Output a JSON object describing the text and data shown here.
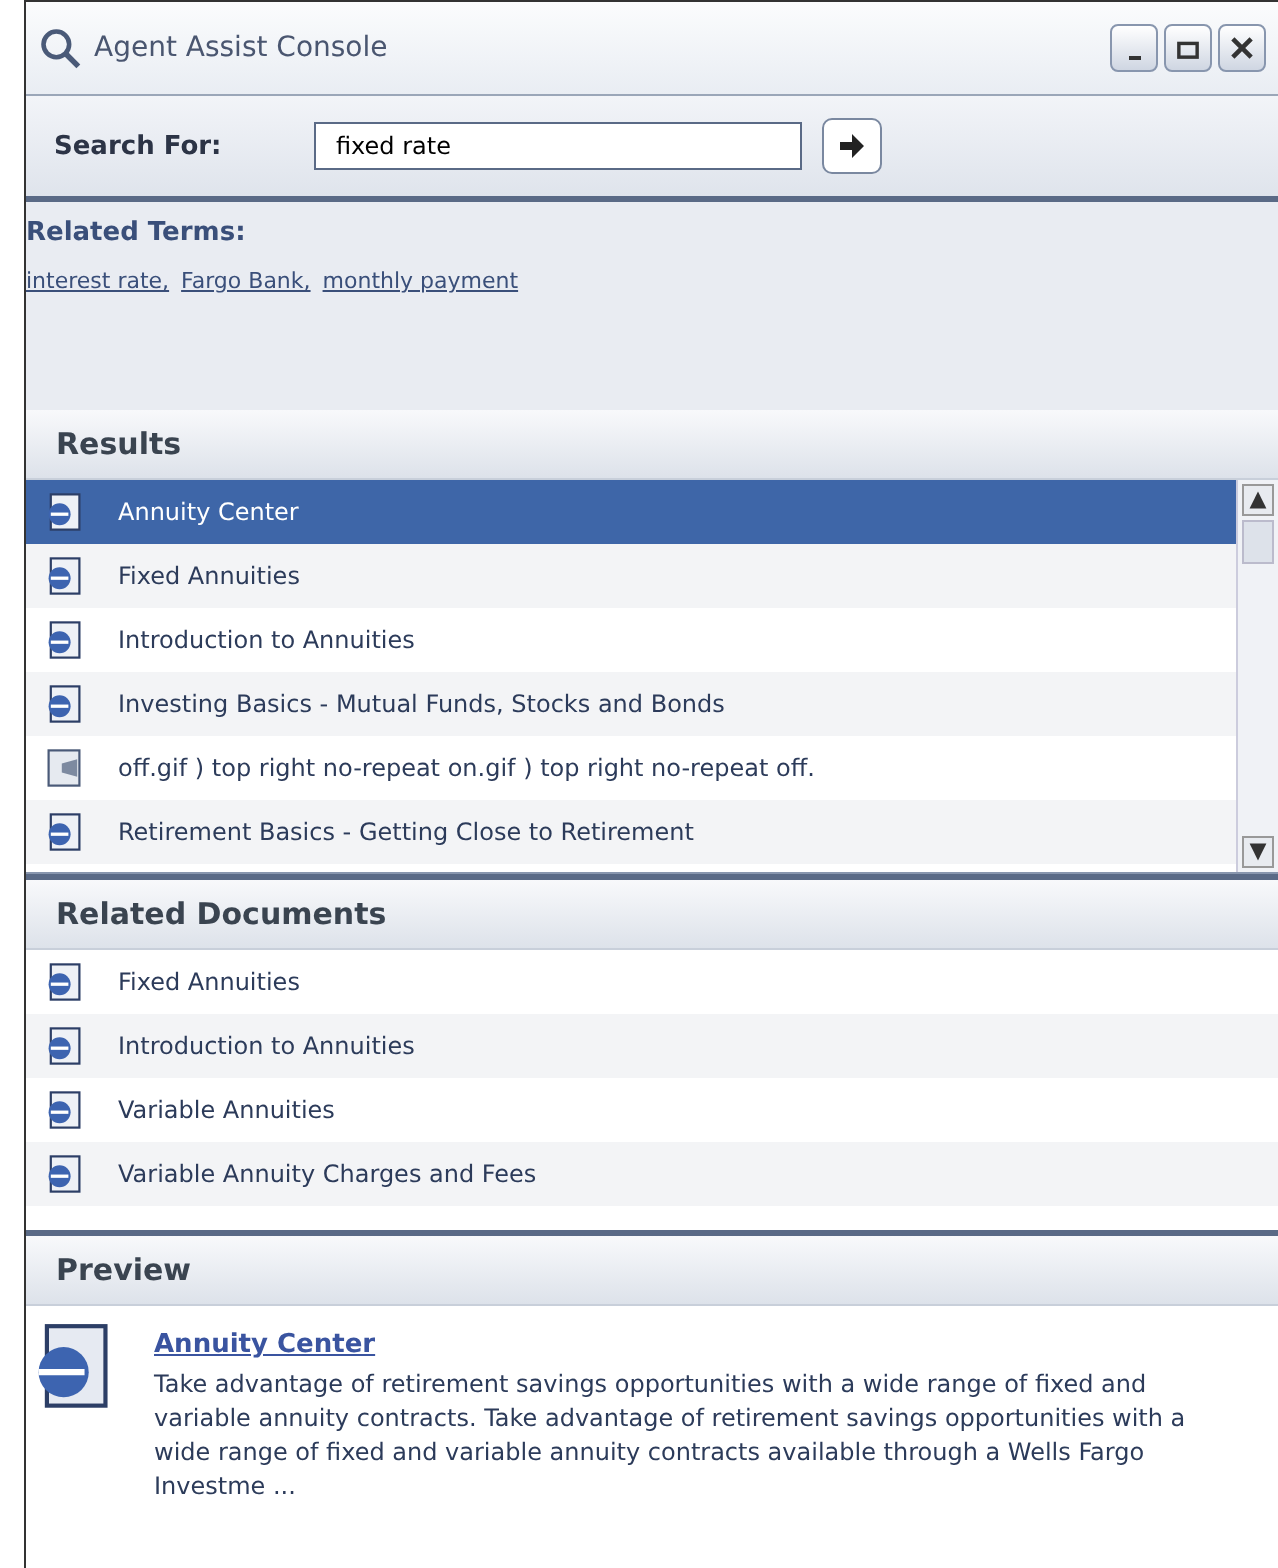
{
  "window": {
    "title": "Agent Assist Console"
  },
  "search": {
    "label": "Search For:",
    "value": "fixed rate"
  },
  "related_terms": {
    "heading": "Related Terms:",
    "links": [
      "interest rate,",
      "Fargo Bank,",
      "monthly payment"
    ]
  },
  "results": {
    "heading": "Results",
    "items": [
      {
        "label": "Annuity Center",
        "kind": "page",
        "selected": true
      },
      {
        "label": "Fixed Annuities",
        "kind": "page",
        "selected": false
      },
      {
        "label": "Introduction to Annuities",
        "kind": "page",
        "selected": false
      },
      {
        "label": "Investing Basics - Mutual Funds, Stocks and Bonds",
        "kind": "page",
        "selected": false
      },
      {
        "label": "off.gif ) top right no-repeat on.gif ) top right no-repeat off.",
        "kind": "image",
        "selected": false
      },
      {
        "label": "Retirement Basics - Getting Close to Retirement",
        "kind": "page",
        "selected": false
      }
    ]
  },
  "related_documents": {
    "heading": "Related Documents",
    "items": [
      {
        "label": "Fixed Annuities"
      },
      {
        "label": "Introduction to Annuities"
      },
      {
        "label": "Variable Annuities"
      },
      {
        "label": "Variable Annuity Charges and Fees"
      }
    ]
  },
  "preview": {
    "heading": "Preview",
    "title": "Annuity Center",
    "text": "Take advantage of retirement savings opportunities with a wide range of fixed and variable annuity contracts. Take advantage of retirement savings opportunities with a wide range of fixed and variable annuity contracts available through a Wells Fargo Investme ..."
  }
}
